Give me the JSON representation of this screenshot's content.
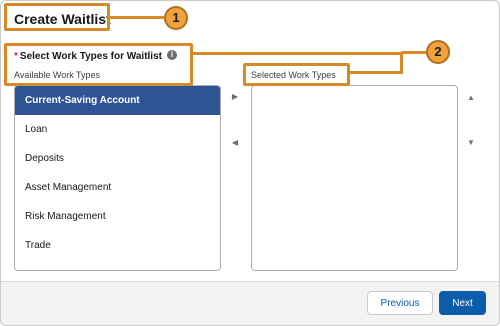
{
  "dialog": {
    "title": "Create Waitlist"
  },
  "field": {
    "required_marker": "*",
    "label": "Select Work Types for Waitlist",
    "info_icon_glyph": "i"
  },
  "available": {
    "caption": "Available Work Types",
    "items": [
      {
        "label": "Current-Saving Account",
        "selected": true
      },
      {
        "label": "Loan",
        "selected": false
      },
      {
        "label": "Deposits",
        "selected": false
      },
      {
        "label": "Asset Management",
        "selected": false
      },
      {
        "label": "Risk Management",
        "selected": false
      },
      {
        "label": "Trade",
        "selected": false
      }
    ]
  },
  "selected": {
    "caption": "Selected Work Types",
    "items": []
  },
  "controls": {
    "move_right_glyph": "▶",
    "move_left_glyph": "◀",
    "move_up_glyph": "▲",
    "move_down_glyph": "▼"
  },
  "footer": {
    "previous_label": "Previous",
    "next_label": "Next"
  },
  "annotations": {
    "badge_1": "1",
    "badge_2": "2",
    "color": "#d88a2a"
  },
  "colors": {
    "selected_item_bg": "#2e5496",
    "brand_button": "#0b5cab",
    "required": "#c23934"
  }
}
